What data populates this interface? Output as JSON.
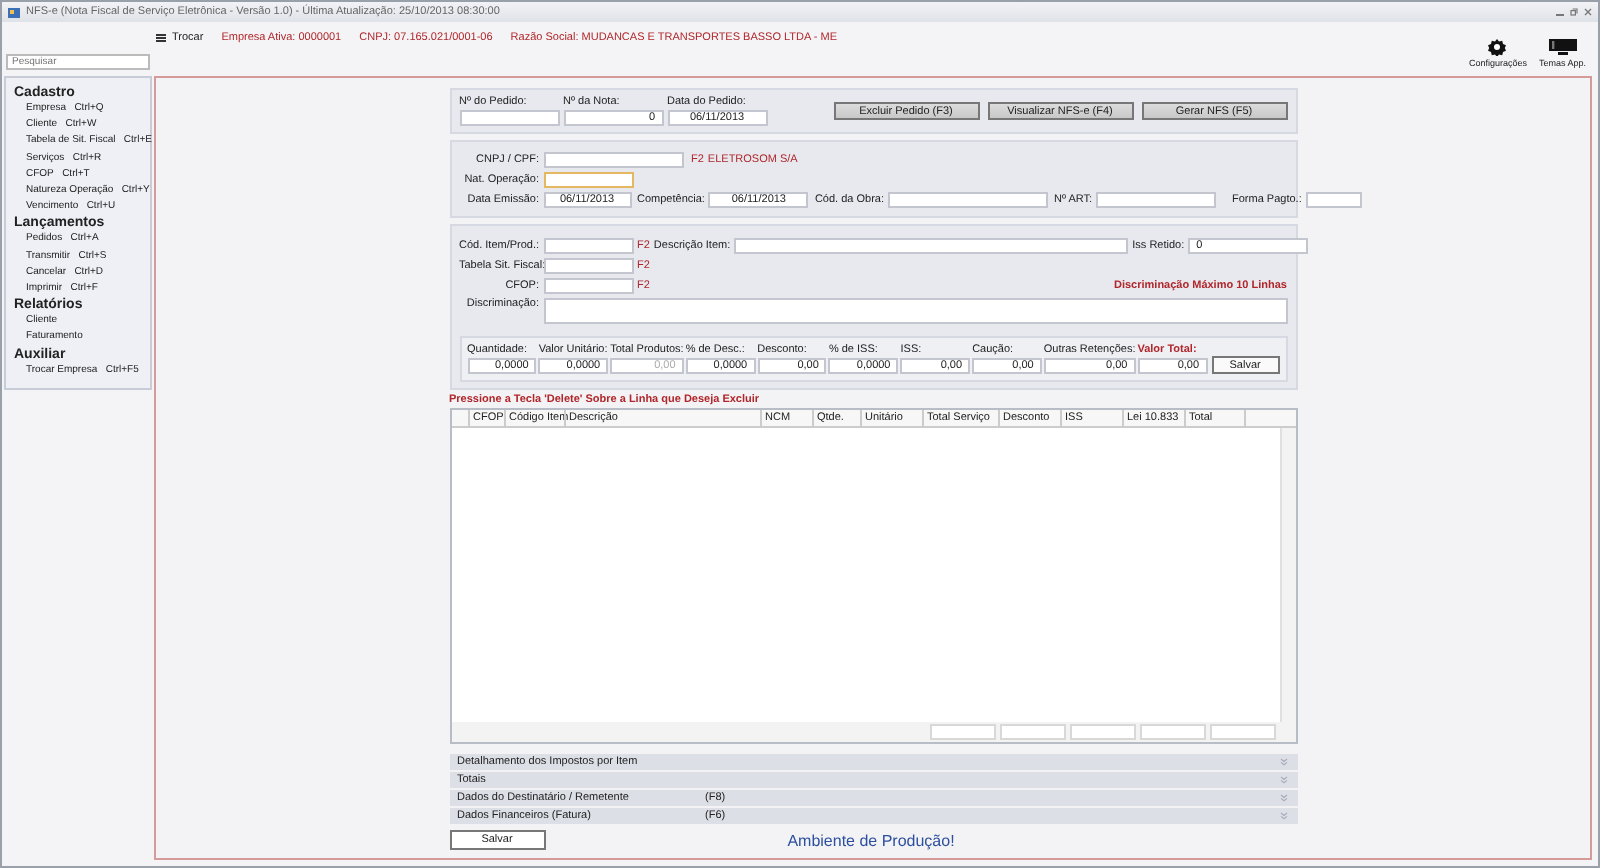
{
  "window": {
    "title": "NFS-e (Nota Fiscal de Serviço Eletrônica - Versão 1.0)  -  Última Atualização: 25/10/2013 08:30:00"
  },
  "header": {
    "switch": "Trocar",
    "company": "Empresa Ativa: 0000001",
    "cnpj": "CNPJ: 07.165.021/0001-06",
    "name": "Razão Social: MUDANCAS E TRANSPORTES BASSO LTDA - ME"
  },
  "toolbar": [
    {
      "label": "Configurações",
      "kind": "gear"
    },
    {
      "label": "Temas App.",
      "kind": "monitor"
    }
  ],
  "sidebar": {
    "search_placeholder": "Pesquisar",
    "sections": [
      {
        "title": "Cadastro",
        "items": [
          {
            "label": "Empresa",
            "shortcut": "Ctrl+Q"
          },
          {
            "label": "Cliente",
            "shortcut": "Ctrl+W"
          },
          {
            "label": "Tabela de Sit. Fiscal",
            "shortcut": "Ctrl+E"
          },
          {
            "label": "Serviços",
            "shortcut": "Ctrl+R"
          },
          {
            "label": "CFOP",
            "shortcut": "Ctrl+T"
          },
          {
            "label": "Natureza Operação",
            "shortcut": "Ctrl+Y"
          },
          {
            "label": "Vencimento",
            "shortcut": "Ctrl+U"
          }
        ]
      },
      {
        "title": "Lançamentos",
        "items": [
          {
            "label": "Pedidos",
            "shortcut": "Ctrl+A"
          },
          {
            "label": "Transmitir",
            "shortcut": "Ctrl+S"
          },
          {
            "label": "Cancelar",
            "shortcut": "Ctrl+D"
          },
          {
            "label": "Imprimir",
            "shortcut": "Ctrl+F"
          }
        ]
      },
      {
        "title": "Relatórios",
        "items": [
          {
            "label": "Cliente"
          },
          {
            "label": "Faturamento"
          }
        ]
      },
      {
        "title": "Auxiliar",
        "items": [
          {
            "label": "Trocar Empresa",
            "shortcut": "Ctrl+F5"
          }
        ]
      }
    ]
  },
  "order": {
    "fields": [
      {
        "label": "Nº do Pedido:"
      },
      {
        "label": "Nº da Nota:",
        "value": "0"
      },
      {
        "label": "Data do Pedido:",
        "value": "06/11/2013"
      }
    ],
    "buttons": [
      "Excluir Pedido (F3)",
      "Visualizar NFS-e (F4)",
      "Gerar NFS (F5)"
    ]
  },
  "customer": {
    "cnpj": {
      "label": "CNPJ / CPF:",
      "key": "F2",
      "name": "ELETROSOM S/A"
    },
    "operation": {
      "label": "Nat. Operação:",
      "focused": true
    },
    "fields": [
      {
        "label": "Data Emissão:",
        "value": "06/11/2013"
      },
      {
        "label": "Competência:",
        "value": "06/11/2013"
      },
      {
        "label": "Cód. da Obra:"
      },
      {
        "label": "Nº ART:"
      },
      {
        "label": "Forma Pagto.:"
      }
    ]
  },
  "item": {
    "code": {
      "label": "Cód. Item/Prod.:",
      "key": "F2"
    },
    "description": {
      "label": "Descrição Item:"
    },
    "iss_withheld": {
      "label": "Iss Retido:",
      "value": "0"
    },
    "tax_table": {
      "label": "Tabela Sit. Fiscal:",
      "key": "F2"
    },
    "cfop": {
      "label": "CFOP:",
      "key": "F2"
    },
    "note": "Discriminação Máximo 10 Linhas",
    "details": {
      "label": "Discriminação:"
    }
  },
  "totals": {
    "fields": [
      {
        "label": "Quantidade:",
        "value": "0,0000",
        "disabled": false,
        "kind": "plain"
      },
      {
        "label": "Valor Unitário:",
        "value": "0,0000",
        "disabled": false,
        "kind": "plain"
      },
      {
        "label": "Total Produtos:",
        "value": "0,00",
        "disabled": true,
        "kind": "plain"
      },
      {
        "label": "% de Desc.:",
        "value": "0,0000",
        "disabled": false,
        "kind": "plain"
      },
      {
        "label": "Desconto:",
        "value": "0,00",
        "disabled": false,
        "kind": "plain"
      },
      {
        "label": "% de ISS:",
        "value": "0,0000",
        "disabled": false,
        "kind": "plain"
      },
      {
        "label": "ISS:",
        "value": "0,00",
        "disabled": false,
        "kind": "plain"
      },
      {
        "label": "Caução:",
        "value": "0,00",
        "disabled": false,
        "kind": "plain"
      },
      {
        "label": "Outras Retenções:",
        "value": "0,00",
        "disabled": false,
        "kind": "plain"
      },
      {
        "label": "Valor Total:",
        "value": "0,00",
        "disabled": false,
        "kind": "total"
      }
    ],
    "button": "Salvar"
  },
  "table": {
    "hint": "Pressione a Tecla 'Delete' Sobre a Linha que Deseja Excluir",
    "columns": [
      "CFOP",
      "Código Item",
      "Descrição",
      "NCM",
      "Qtde.",
      "Unitário",
      "Total Serviço",
      "Desconto",
      "ISS",
      "Lei 10.833",
      "Total"
    ]
  },
  "panels": [
    {
      "label": "Detalhamento dos Impostos por Item",
      "expanded": false
    },
    {
      "label": "Totais",
      "expanded": false
    },
    {
      "label": "Dados do Destinatário / Remetente",
      "key": "(F8)",
      "expanded": false
    },
    {
      "label": "Dados Financeiros (Fatura)",
      "key": "(F6)",
      "expanded": false
    }
  ],
  "footer": {
    "save": "Salvar",
    "environment": "Ambiente de Produção!"
  }
}
